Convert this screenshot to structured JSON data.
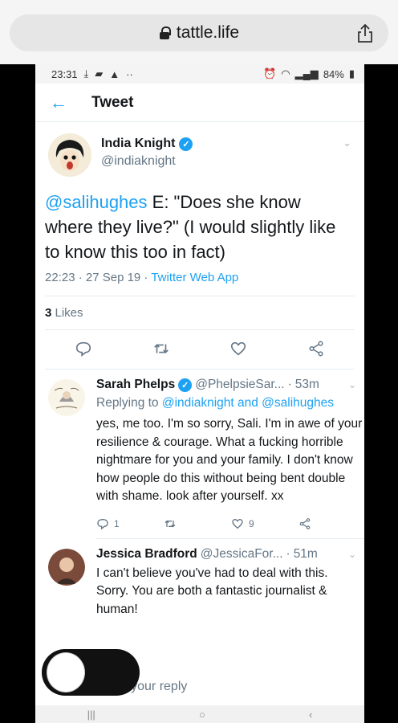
{
  "browser": {
    "url": "tattle.life"
  },
  "status_bar": {
    "time": "23:31",
    "battery": "84%"
  },
  "header": {
    "title": "Tweet"
  },
  "main_tweet": {
    "author_name": "India Knight",
    "author_handle": "@indiaknight",
    "mention": "@salihughes",
    "text": " E: \"Does she know where they live?\" (I would slightly like to know this too in fact)",
    "timestamp": "22:23 · 27 Sep 19 · ",
    "source_app": "Twitter Web App",
    "likes_count": "3",
    "likes_label": " Likes"
  },
  "replies": [
    {
      "name": "Sarah Phelps",
      "handle": "@PhelpsieSar...",
      "time": "53m",
      "replying_prefix": "Replying to ",
      "replying_to": "@indiaknight and @salihughes",
      "text": "yes, me too.  I'm so sorry, Sali. I'm in awe of your resilience & courage.  What a fucking horrible nightmare for you and your family.  I don't know how people do this without being bent double with shame. look after yourself. xx",
      "reply_count": "1",
      "like_count": "9"
    },
    {
      "name": "Jessica Bradford",
      "handle": "@JessicaFor...",
      "time": "51m",
      "text": "I can't believe you've had to deal with this. Sorry. You are both a fantastic journalist & human!"
    }
  ],
  "reply_box": {
    "label": "Tweet your reply"
  },
  "colors": {
    "accent": "#1da1f2",
    "muted": "#657786",
    "text": "#14171a"
  }
}
